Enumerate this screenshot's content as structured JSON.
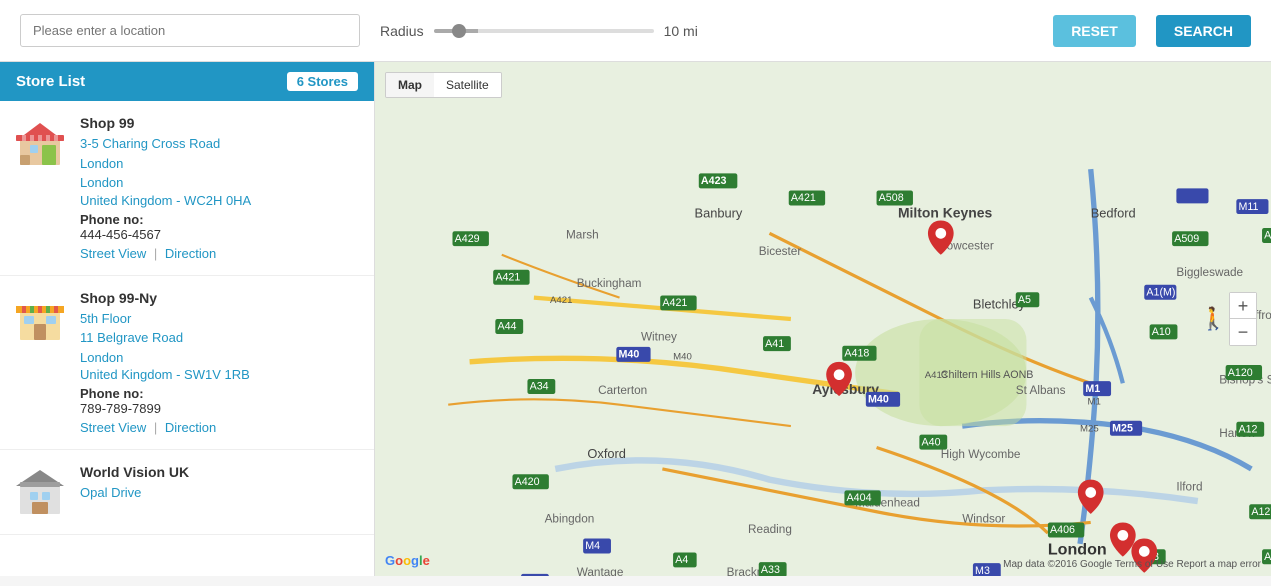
{
  "topbar": {
    "search_placeholder": "Please enter a location",
    "radius_label": "Radius",
    "radius_value": "10 mi",
    "btn_reset": "RESET",
    "btn_search": "SEARCH"
  },
  "store_list": {
    "title": "Store List",
    "count": "6 Stores",
    "stores": [
      {
        "name": "Shop 99",
        "address1": "3-5 Charing Cross Road",
        "address2": "London",
        "address3": "London",
        "country": "United Kingdom - WC2H 0HA",
        "phone_label": "Phone no:",
        "phone": "444-456-4567",
        "street_view": "Street View",
        "direction": "Direction"
      },
      {
        "name": "Shop 99-Ny",
        "address1": "5th Floor",
        "address2": "11 Belgrave Road",
        "address3": "London",
        "country": "United Kingdom - SW1V 1RB",
        "phone_label": "Phone no:",
        "phone": "789-789-7899",
        "street_view": "Street View",
        "direction": "Direction"
      },
      {
        "name": "World Vision UK",
        "address1": "Opal Drive",
        "address2": "",
        "address3": "",
        "country": "",
        "phone_label": "",
        "phone": "",
        "street_view": "",
        "direction": ""
      }
    ]
  },
  "map": {
    "tab_map": "Map",
    "tab_satellite": "Satellite",
    "google_label": "Google",
    "footer_text": "Map data ©2016 Google   Terms of Use   Report a map error",
    "zoom_in": "+",
    "zoom_out": "−"
  }
}
